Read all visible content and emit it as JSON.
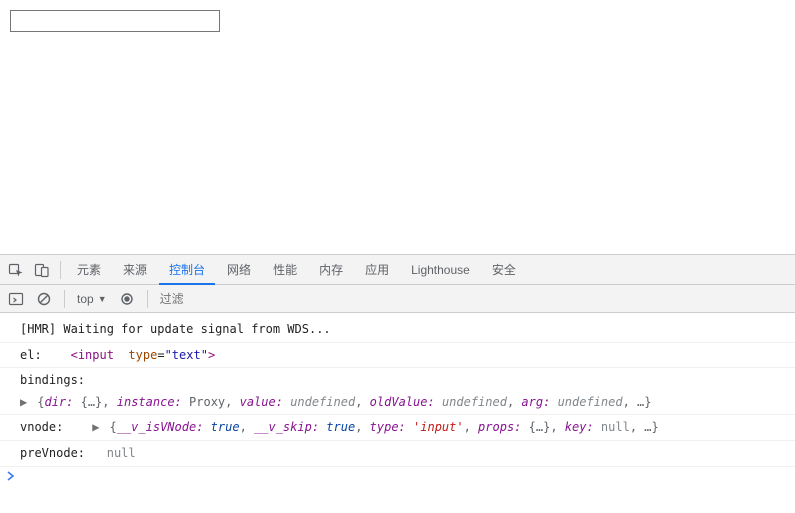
{
  "page": {
    "input_value": ""
  },
  "devtools": {
    "tabs": [
      "元素",
      "来源",
      "控制台",
      "网络",
      "性能",
      "内存",
      "应用",
      "Lighthouse",
      "安全"
    ],
    "active_tab_index": 2,
    "toolbar": {
      "context": "top",
      "filter_placeholder": "过滤"
    }
  },
  "console": {
    "hmr": "[HMR] Waiting for update signal from WDS...",
    "el": {
      "label": "el:",
      "tag": "input",
      "attr_name": "type",
      "attr_value": "text"
    },
    "bindings": {
      "label": "bindings:",
      "keys": {
        "dir": "dir:",
        "instance": "instance:",
        "value": "value:",
        "oldValue": "oldValue:",
        "arg": "arg:"
      },
      "vals": {
        "dir": "{…}",
        "instance": "Proxy",
        "value": "undefined",
        "oldValue": "undefined",
        "arg": "undefined"
      }
    },
    "vnode": {
      "label": "vnode:",
      "keys": {
        "isVNode": "__v_isVNode:",
        "skip": "__v_skip:",
        "type": "type:",
        "props": "props:",
        "key": "key:"
      },
      "vals": {
        "isVNode": "true",
        "skip": "true",
        "type": "'input'",
        "props": "{…}",
        "key": "null"
      }
    },
    "preVnode": {
      "label": "preVnode:",
      "value": "null"
    }
  }
}
